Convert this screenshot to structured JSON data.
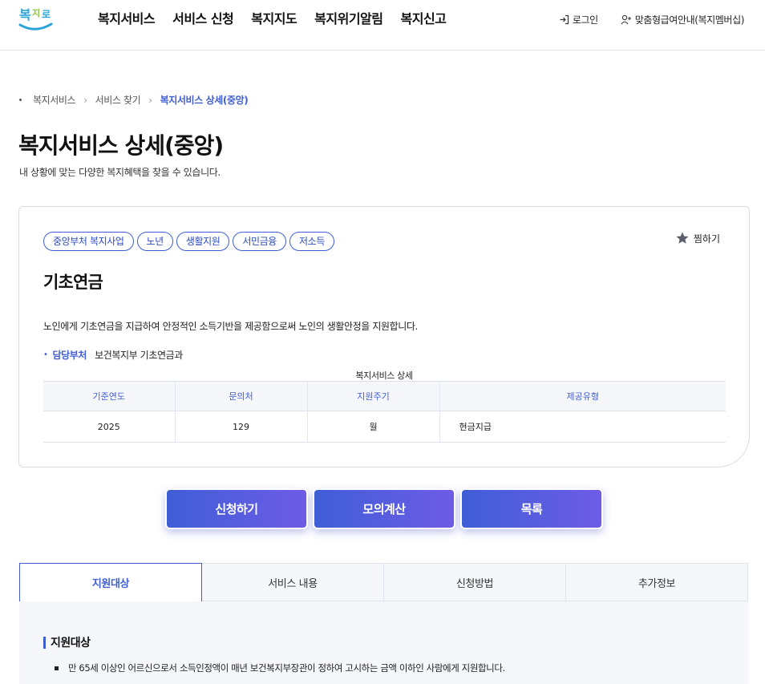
{
  "header": {
    "logo_text": "복지로",
    "nav": [
      "복지서비스",
      "서비스 신청",
      "복지지도",
      "복지위기알림",
      "복지신고"
    ],
    "util": {
      "login": "로그인",
      "membership": "맞춤형급여안내(복지멤버십)"
    }
  },
  "breadcrumb": [
    "복지서비스",
    "서비스 찾기",
    "복지서비스 상세(중앙)"
  ],
  "page": {
    "title": "복지서비스 상세(중앙)",
    "description": "내 상황에 맞는 다양한 복지혜택을 찾을 수 있습니다."
  },
  "service": {
    "tags": [
      "중앙부처 복지사업",
      "노년",
      "생활지원",
      "서민금융",
      "저소득"
    ],
    "bookmark_label": "찜하기",
    "name": "기초연금",
    "summary": "노인에게 기초연금을 지급하여 안정적인 소득기반을 제공함으로써 노인의 생활안정을 지원합니다.",
    "dept_label": "담당부처",
    "dept_value": "보건복지부 기초연금과",
    "table_caption": "복지서비스 상세",
    "table": {
      "headers": [
        "기준연도",
        "문의처",
        "지원주기",
        "제공유형"
      ],
      "row": [
        "2025",
        "129",
        "월",
        "현금지급"
      ]
    }
  },
  "actions": {
    "apply": "신청하기",
    "simulate": "모의계산",
    "list": "목록"
  },
  "tabs": [
    "지원대상",
    "서비스 내용",
    "신청방법",
    "추가정보"
  ],
  "active_tab": "지원대상",
  "content": {
    "section_title": "지원대상",
    "items": [
      "만 65세 이상인 어르신으로서 소득인정액이 매년 보건복지부장관이 정하여 고시하는 금액 이하인 사람에게 지원합니다."
    ]
  },
  "colors": {
    "accent": "#3f5ed6",
    "accent_end": "#6e5ce6",
    "logo_green": "#8cc63f",
    "logo_blue": "#29a3d9"
  }
}
